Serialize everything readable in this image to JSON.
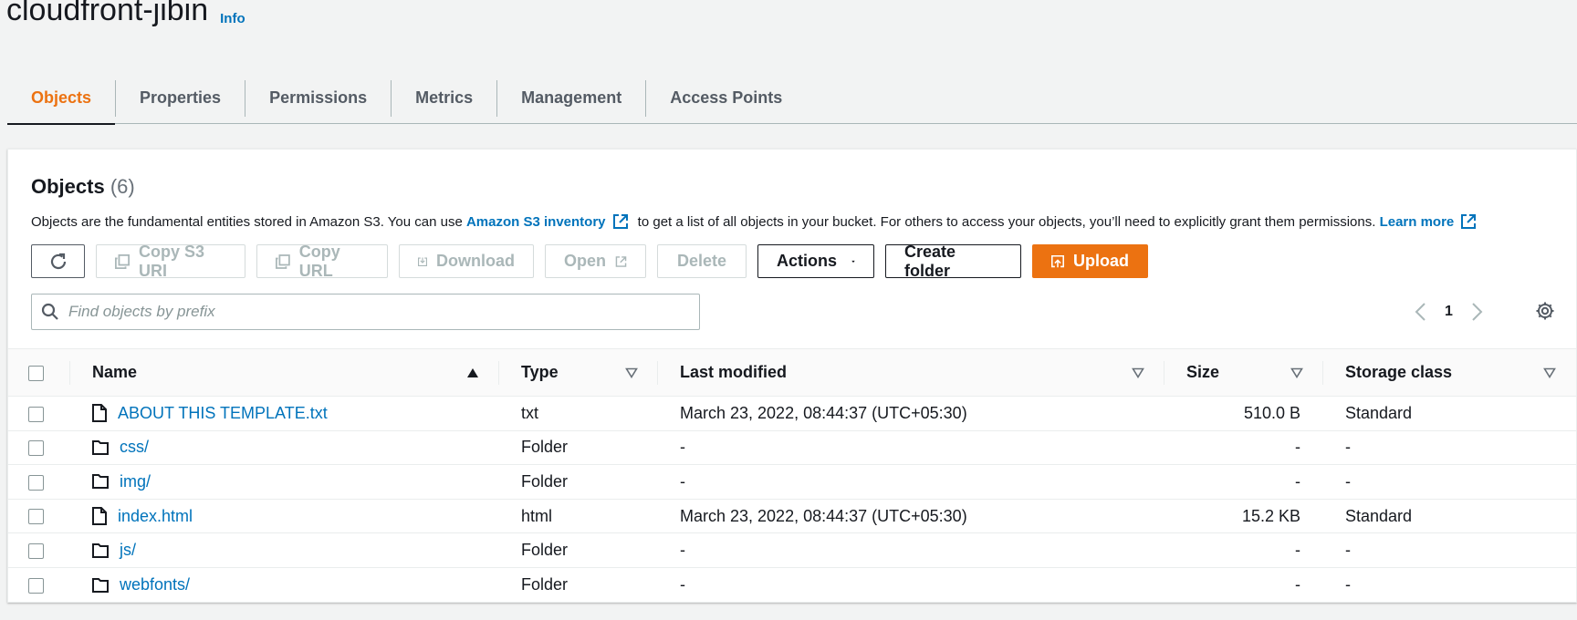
{
  "bucket": {
    "name": "cloudfront-jibin",
    "info_label": "Info"
  },
  "tabs": [
    {
      "label": "Objects",
      "active": true
    },
    {
      "label": "Properties"
    },
    {
      "label": "Permissions"
    },
    {
      "label": "Metrics"
    },
    {
      "label": "Management"
    },
    {
      "label": "Access Points"
    }
  ],
  "objects_panel": {
    "title": "Objects",
    "count": "(6)",
    "desc_part1": "Objects are the fundamental entities stored in Amazon S3. You can use ",
    "inventory_link": "Amazon S3 inventory",
    "desc_part2": " to get a list of all objects in your bucket. For others to access your objects, you’ll need to explicitly grant them permissions. ",
    "learn_more": "Learn more"
  },
  "toolbar": {
    "copy_s3_uri": "Copy S3 URI",
    "copy_url": "Copy URL",
    "download": "Download",
    "open": "Open",
    "delete": "Delete",
    "actions": "Actions",
    "create_folder": "Create folder",
    "upload": "Upload"
  },
  "search": {
    "placeholder": "Find objects by prefix"
  },
  "pagination": {
    "page": "1"
  },
  "table": {
    "headers": {
      "name": "Name",
      "type": "Type",
      "last_modified": "Last modified",
      "size": "Size",
      "storage_class": "Storage class"
    },
    "rows": [
      {
        "name": "ABOUT THIS TEMPLATE.txt",
        "icon": "file-icon",
        "type": "txt",
        "last_modified": "March 23, 2022, 08:44:37 (UTC+05:30)",
        "size": "510.0 B",
        "storage_class": "Standard"
      },
      {
        "name": "css/",
        "icon": "folder-icon",
        "type": "Folder",
        "last_modified": "-",
        "size": "-",
        "storage_class": "-"
      },
      {
        "name": "img/",
        "icon": "folder-icon",
        "type": "Folder",
        "last_modified": "-",
        "size": "-",
        "storage_class": "-"
      },
      {
        "name": "index.html",
        "icon": "file-icon",
        "type": "html",
        "last_modified": "March 23, 2022, 08:44:37 (UTC+05:30)",
        "size": "15.2 KB",
        "storage_class": "Standard"
      },
      {
        "name": "js/",
        "icon": "folder-icon",
        "type": "Folder",
        "last_modified": "-",
        "size": "-",
        "storage_class": "-"
      },
      {
        "name": "webfonts/",
        "icon": "folder-icon",
        "type": "Folder",
        "last_modified": "-",
        "size": "-",
        "storage_class": "-"
      }
    ]
  },
  "colors": {
    "accent": "#ec7211",
    "link": "#0073bb",
    "text": "#16191f",
    "muted": "#545b64",
    "disabled": "#aab7b8"
  }
}
